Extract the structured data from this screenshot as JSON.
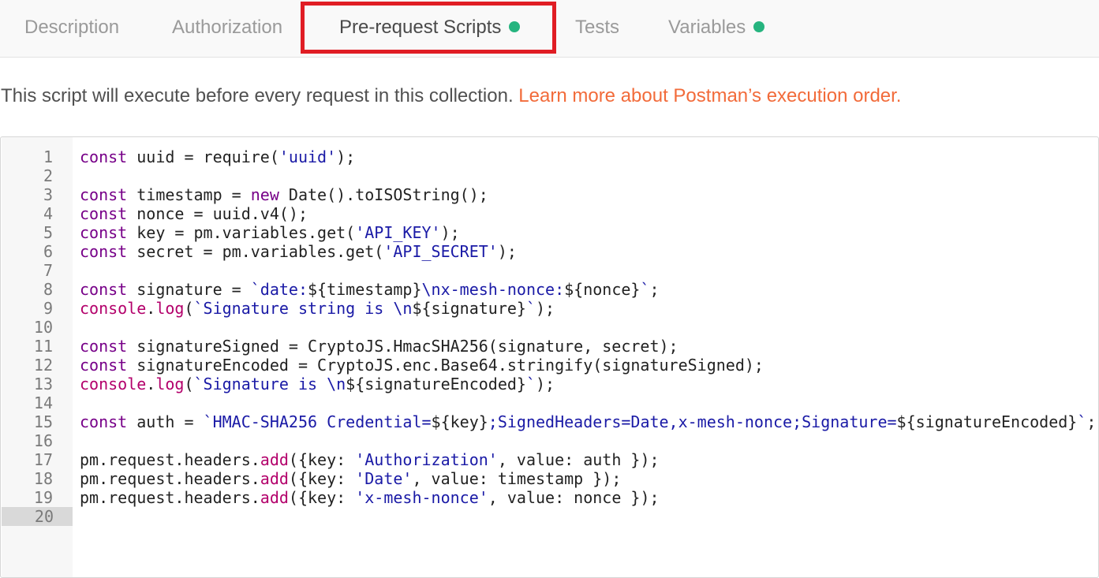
{
  "tabs": [
    {
      "label": "Description",
      "active": false,
      "has_dot": false
    },
    {
      "label": "Authorization",
      "active": false,
      "has_dot": false
    },
    {
      "label": "Pre-request Scripts",
      "active": true,
      "has_dot": true
    },
    {
      "label": "Tests",
      "active": false,
      "has_dot": false
    },
    {
      "label": "Variables",
      "active": false,
      "has_dot": true
    }
  ],
  "info": {
    "text": "This script will execute before every request in this collection. ",
    "link": "Learn more about Postman’s execution order."
  },
  "colors": {
    "highlight": "#e01d24",
    "dot": "#26b47f",
    "link": "#f26b3a",
    "keyword": "#770088",
    "string": "#1a1aa6"
  },
  "editor": {
    "current_line": 20,
    "lines": [
      "const uuid = require('uuid');",
      "",
      "const timestamp = new Date().toISOString();",
      "const nonce = uuid.v4();",
      "const key = pm.variables.get('API_KEY');",
      "const secret = pm.variables.get('API_SECRET');",
      "",
      "const signature = `date:${timestamp}\\nx-mesh-nonce:${nonce}`;",
      "console.log(`Signature string is \\n${signature}`);",
      "",
      "const signatureSigned = CryptoJS.HmacSHA256(signature, secret);",
      "const signatureEncoded = CryptoJS.enc.Base64.stringify(signatureSigned);",
      "console.log(`Signature is \\n${signatureEncoded}`);",
      "",
      "const auth = `HMAC-SHA256 Credential=${key};SignedHeaders=Date,x-mesh-nonce;Signature=${signatureEncoded}`;",
      "",
      "pm.request.headers.add({key: 'Authorization', value: auth });",
      "pm.request.headers.add({key: 'Date', value: timestamp });",
      "pm.request.headers.add({key: 'x-mesh-nonce', value: nonce });",
      ""
    ]
  }
}
